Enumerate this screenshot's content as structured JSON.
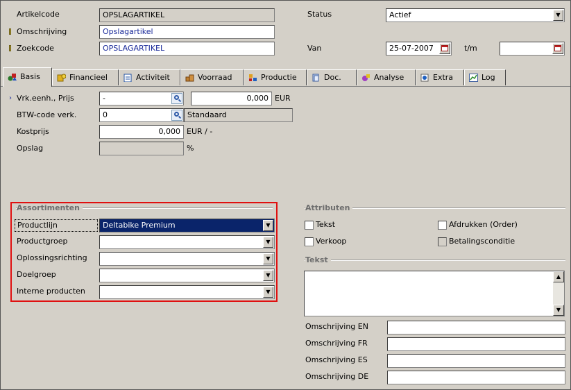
{
  "header": {
    "artikelcode_label": "Artikelcode",
    "artikelcode_value": "OPSLAGARTIKEL",
    "omschrijving_label": "Omschrijving",
    "omschrijving_value": "Opslagartikel",
    "zoekcode_label": "Zoekcode",
    "zoekcode_value": "OPSLAGARTIKEL",
    "status_label": "Status",
    "status_value": "Actief",
    "van_label": "Van",
    "van_value": "25-07-2007",
    "tm_label": "t/m",
    "tm_value": ""
  },
  "tabs": [
    {
      "label": "Basis",
      "icon": "shapes-icon",
      "active": true
    },
    {
      "label": "Financieel",
      "icon": "coins-icon"
    },
    {
      "label": "Activiteit",
      "icon": "clipboard-icon"
    },
    {
      "label": "Voorraad",
      "icon": "boxes-icon"
    },
    {
      "label": "Productie",
      "icon": "blocks-icon"
    },
    {
      "label": "Doc.",
      "icon": "document-icon"
    },
    {
      "label": "Analyse",
      "icon": "analysis-icon"
    },
    {
      "label": "Extra",
      "icon": "extra-icon"
    },
    {
      "label": "Log",
      "icon": "chart-icon"
    }
  ],
  "basis": {
    "vrk_label": "Vrk.eenh., Prijs",
    "vrk_unit_value": "-",
    "vrk_price_value": "0,000",
    "vrk_currency": "EUR",
    "btw_label": "BTW-code verk.",
    "btw_value": "0",
    "btw_desc": "Standaard",
    "kostprijs_label": "Kostprijs",
    "kostprijs_value": "0,000",
    "kostprijs_unit": "EUR / -",
    "opslag_label": "Opslag",
    "opslag_value": "",
    "opslag_unit": "%"
  },
  "assortimenten": {
    "title": "Assortimenten",
    "fields": [
      {
        "label": "Productlijn",
        "value": "Deltabike Premium"
      },
      {
        "label": "Productgroep",
        "value": ""
      },
      {
        "label": "Oplossingsrichting",
        "value": ""
      },
      {
        "label": "Doelgroep",
        "value": ""
      },
      {
        "label": "Interne producten",
        "value": ""
      }
    ]
  },
  "attributen": {
    "title": "Attributen",
    "tekst_label": "Tekst",
    "verkoop_label": "Verkoop",
    "afdrukken_label": "Afdrukken (Order)",
    "betaling_label": "Betalingsconditie"
  },
  "tekst": {
    "title": "Tekst",
    "value": "",
    "omschrijvingen": [
      {
        "label": "Omschrijving EN",
        "value": ""
      },
      {
        "label": "Omschrijving FR",
        "value": ""
      },
      {
        "label": "Omschrijving ES",
        "value": ""
      },
      {
        "label": "Omschrijving DE",
        "value": ""
      }
    ]
  },
  "colors": {
    "background": "#d4d0c8",
    "highlight_box": "#e01010",
    "selection": "#0a246a"
  }
}
